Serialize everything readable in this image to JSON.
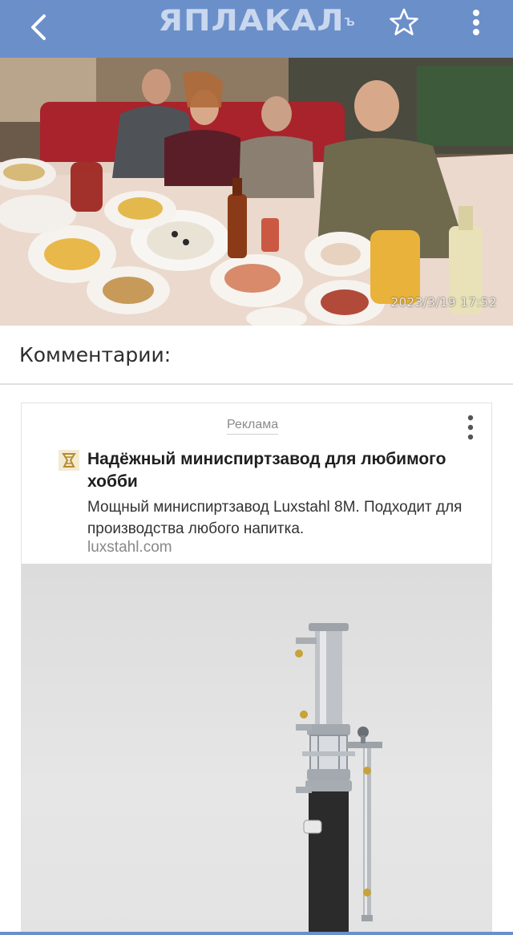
{
  "header": {
    "logo_text": "ЯПЛАКАЛ",
    "logo_sup": "ъ",
    "back_icon": "chevron-left-icon",
    "favorite_icon": "star-outline-icon",
    "menu_icon": "more-vertical-icon",
    "bar_color": "#6b8fc9"
  },
  "post_photo": {
    "timestamp": "2023/3/19  17:52"
  },
  "comments": {
    "title": "Комментарии:"
  },
  "ad": {
    "label": "Реклама",
    "menu_icon": "more-vertical-icon",
    "title": "Надёжный миниспиртзавод для любимого хобби",
    "description": "Мощный миниспиртзавод Luxstahl 8M. Подходит для производства любого напитка.",
    "domain": "luxstahl.com"
  }
}
